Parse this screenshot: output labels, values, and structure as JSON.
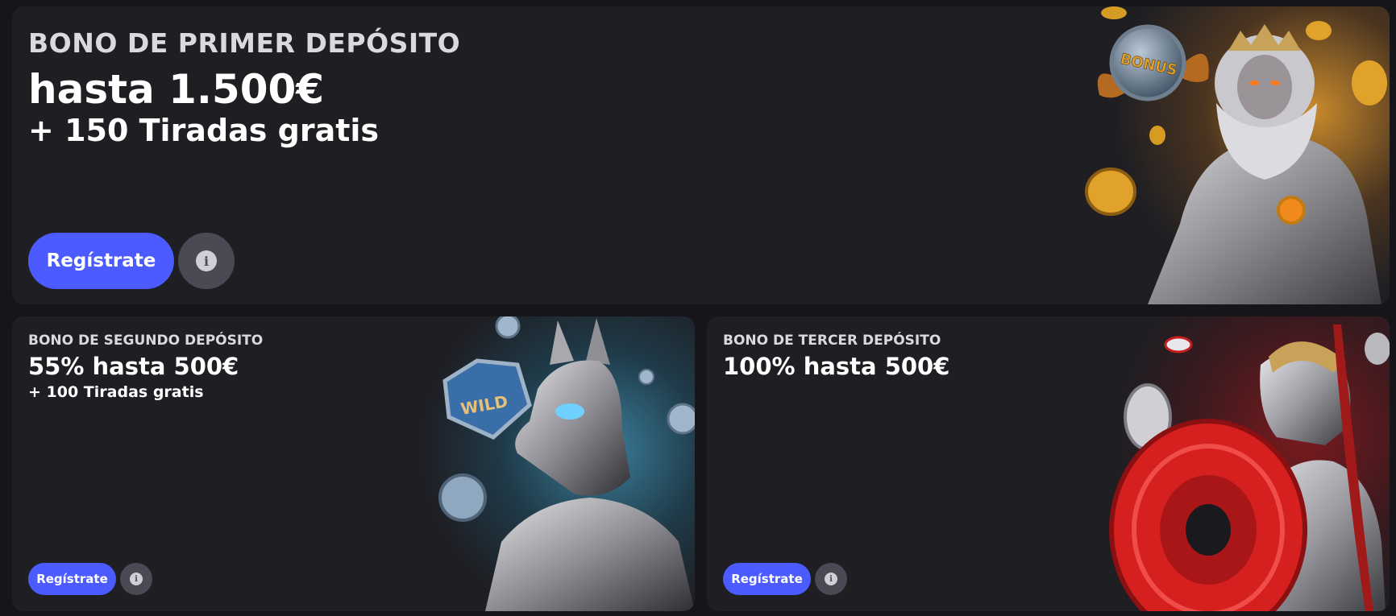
{
  "cards": [
    {
      "eyebrow": "BONO DE PRIMER DEPÓSITO",
      "amount": "hasta 1.500€",
      "spins": "+ 150 Tiradas gratis",
      "register_label": "Regístrate",
      "art": "zeus-with-bonus-coin-illustration"
    },
    {
      "eyebrow": "BONO DE SEGUNDO DEPÓSITO",
      "amount": "55% hasta 500€",
      "spins": "+ 100 Tiradas gratis",
      "register_label": "Regístrate",
      "art": "anubis-with-wild-gem-illustration",
      "art_text": "WILD"
    },
    {
      "eyebrow": "BONO DE TERCER DEPÓSITO",
      "amount": "100% hasta 500€",
      "register_label": "Regístrate",
      "art": "athena-with-red-shield-illustration"
    }
  ],
  "bonus_coin_text": "BONUS",
  "colors": {
    "page_bg": "#15151a",
    "card_bg": "#1e1e23",
    "accent": "#4b5bff",
    "info_button": "#4a4a54",
    "gold": "#e0a22a",
    "red": "#d5201f"
  }
}
